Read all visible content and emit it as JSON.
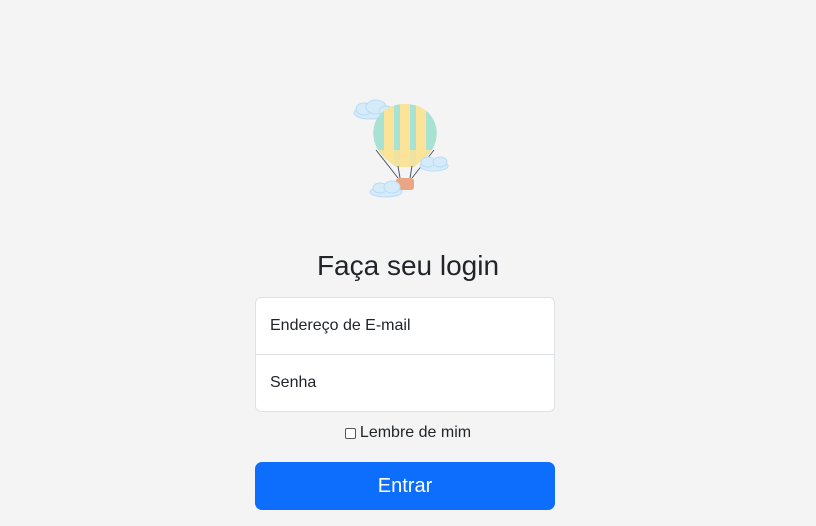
{
  "logo": {
    "icon": "hot-air-balloon-icon",
    "colors": {
      "balloon_stripe_a": "#a8e2d2",
      "balloon_stripe_b": "#fbe39a",
      "basket": "#e9a584",
      "cloud": "#cfe6f7"
    }
  },
  "login": {
    "title": "Faça seu login",
    "email_placeholder": "Endereço de E-mail",
    "password_placeholder": "Senha",
    "remember_label": "Lembre de mim",
    "submit_label": "Entrar"
  },
  "colors": {
    "background": "#f4f4f5",
    "primary": "#0d6efd",
    "border": "#dee2e6"
  }
}
